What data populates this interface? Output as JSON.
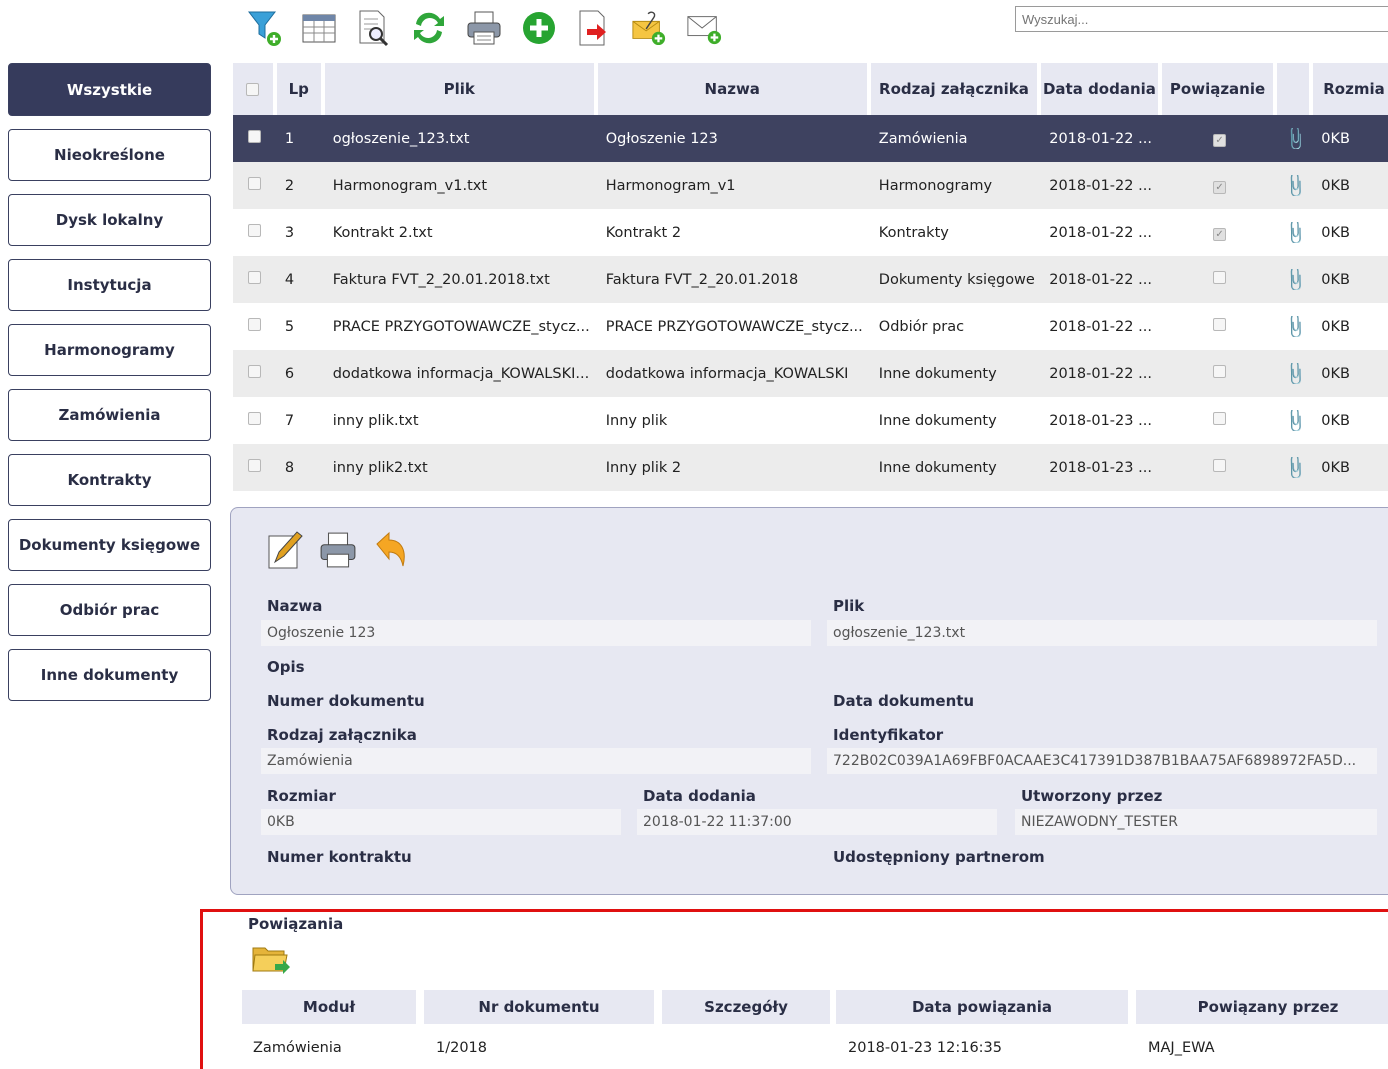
{
  "toolbar": {
    "icons": [
      "filter-add-icon",
      "table-icon",
      "preview-icon",
      "refresh-icon",
      "print-icon",
      "add-icon",
      "export-icon",
      "attach-add-icon",
      "mail-add-icon"
    ]
  },
  "search": {
    "placeholder": "Wyszukaj..."
  },
  "sidebar": {
    "items": [
      {
        "label": "Wszystkie",
        "active": true
      },
      {
        "label": "Nieokreślone"
      },
      {
        "label": "Dysk lokalny"
      },
      {
        "label": "Instytucja"
      },
      {
        "label": "Harmonogramy"
      },
      {
        "label": "Zamówienia"
      },
      {
        "label": "Kontrakty"
      },
      {
        "label": "Dokumenty księgowe"
      },
      {
        "label": "Odbiór prac"
      },
      {
        "label": "Inne dokumenty"
      }
    ]
  },
  "grid": {
    "headers": {
      "lp": "Lp",
      "plik": "Plik",
      "nazwa": "Nazwa",
      "rodzaj": "Rodzaj załącznika",
      "data": "Data dodania",
      "powiazanie": "Powiązanie",
      "rozmiar": "Rozmia"
    },
    "rows": [
      {
        "lp": "1",
        "plik": "ogłoszenie_123.txt",
        "nazwa": "Ogłoszenie 123",
        "rodzaj": "Zamówienia",
        "data": "2018-01-22 ...",
        "linked": true,
        "size": "0KB"
      },
      {
        "lp": "2",
        "plik": "Harmonogram_v1.txt",
        "nazwa": "Harmonogram_v1",
        "rodzaj": "Harmonogramy",
        "data": "2018-01-22 ...",
        "linked": true,
        "size": "0KB"
      },
      {
        "lp": "3",
        "plik": "Kontrakt 2.txt",
        "nazwa": "Kontrakt 2",
        "rodzaj": "Kontrakty",
        "data": "2018-01-22 ...",
        "linked": true,
        "size": "0KB"
      },
      {
        "lp": "4",
        "plik": "Faktura FVT_2_20.01.2018.txt",
        "nazwa": "Faktura FVT_2_20.01.2018",
        "rodzaj": "Dokumenty księgowe",
        "data": "2018-01-22 ...",
        "linked": false,
        "size": "0KB"
      },
      {
        "lp": "5",
        "plik": "PRACE PRZYGOTOWAWCZE_stycz...",
        "nazwa": "PRACE PRZYGOTOWAWCZE_stycz...",
        "rodzaj": "Odbiór prac",
        "data": "2018-01-22 ...",
        "linked": false,
        "size": "0KB"
      },
      {
        "lp": "6",
        "plik": "dodatkowa informacja_KOWALSKI...",
        "nazwa": "dodatkowa informacja_KOWALSKI",
        "rodzaj": "Inne dokumenty",
        "data": "2018-01-22 ...",
        "linked": false,
        "size": "0KB"
      },
      {
        "lp": "7",
        "plik": "inny plik.txt",
        "nazwa": "Inny plik",
        "rodzaj": "Inne dokumenty",
        "data": "2018-01-23 ...",
        "linked": false,
        "size": "0KB"
      },
      {
        "lp": "8",
        "plik": "inny plik2.txt",
        "nazwa": "Inny plik 2",
        "rodzaj": "Inne dokumenty",
        "data": "2018-01-23 ...",
        "linked": false,
        "size": "0KB"
      }
    ]
  },
  "detail": {
    "nazwa_label": "Nazwa",
    "nazwa": "Ogłoszenie 123",
    "plik_label": "Plik",
    "plik": "ogłoszenie_123.txt",
    "opis_label": "Opis",
    "numer_label": "Numer dokumentu",
    "data_dok_label": "Data dokumentu",
    "rodzaj_label": "Rodzaj załącznika",
    "rodzaj": "Zamówienia",
    "ident_label": "Identyfikator",
    "ident": "722B02C039A1A69FBF0ACAAE3C417391D387B1BAA75AF6898972FA5D...",
    "rozmiar_label": "Rozmiar",
    "rozmiar": "0KB",
    "data_dod_label": "Data dodania",
    "data_dod": "2018-01-22 11:37:00",
    "utworzony_label": "Utworzony przez",
    "utworzony": "NIEZAWODNY_TESTER",
    "kontrakt_label": "Numer kontraktu",
    "udost_label": "Udostępniony partnerom"
  },
  "links": {
    "title": "Powiązania",
    "headers": {
      "modul": "Moduł",
      "nr": "Nr dokumentu",
      "szczegoly": "Szczegóły",
      "data": "Data powiązania",
      "przez": "Powiązany przez"
    },
    "row": {
      "modul": "Zamówienia",
      "nr": "1/2018",
      "szczegoly": "",
      "data": "2018-01-23 12:16:35",
      "przez": "MAJ_EWA"
    }
  },
  "colors": {
    "accent": "#363b5c",
    "header_bg": "#e7e8f2",
    "highlight_border": "#e01010"
  }
}
